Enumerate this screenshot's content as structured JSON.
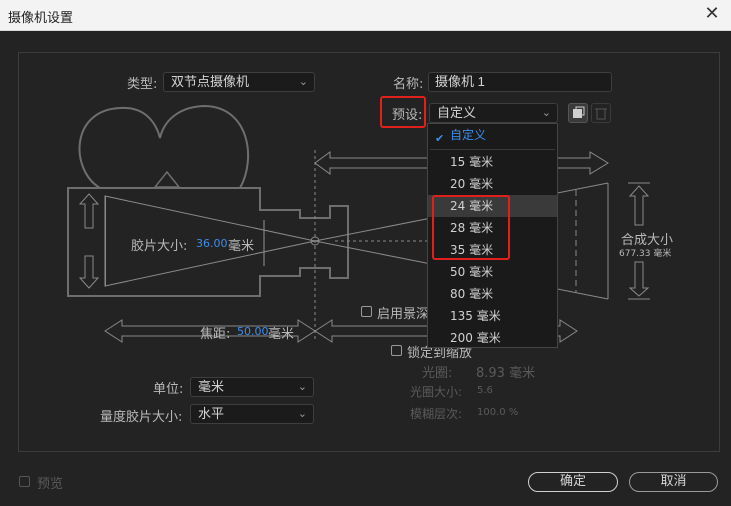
{
  "window": {
    "title": "摄像机设置",
    "close_glyph": "✕"
  },
  "type": {
    "label": "类型:",
    "value": "双节点摄像机"
  },
  "name": {
    "label": "名称:",
    "value": "摄像机 1"
  },
  "preset": {
    "label": "预设:",
    "value": "自定义",
    "options": [
      "自定义",
      "15 毫米",
      "20 毫米",
      "24 毫米",
      "28 毫米",
      "35 毫米",
      "50 毫米",
      "80 毫米",
      "135 毫米",
      "200 毫米"
    ],
    "selected_index": 0,
    "hovered_index": 3
  },
  "film_size": {
    "label": "胶片大小:",
    "value": "36.00",
    "unit": "毫米"
  },
  "focal": {
    "label": "焦距:",
    "value": "50.00",
    "unit": "毫米"
  },
  "comp_size": {
    "label": "合成大小",
    "value": "677.33 毫米"
  },
  "dof": {
    "label": "启用景深"
  },
  "lock_zoom": {
    "label": "锁定到缩放"
  },
  "aperture": {
    "label": "光圈:",
    "value": "8.93 毫米"
  },
  "fstop": {
    "label": "光圈大小:",
    "value": "5.6"
  },
  "blur": {
    "label": "模糊层次:",
    "value": "100.0 %"
  },
  "units": {
    "label": "单位:",
    "value": "毫米"
  },
  "measure": {
    "label": "量度胶片大小:",
    "value": "水平"
  },
  "preview": {
    "label": "预览"
  },
  "buttons": {
    "ok": "确定",
    "cancel": "取消"
  },
  "colors": {
    "accent": "#3d8ee9",
    "highlight_box": "#e0201a",
    "bg": "#232323"
  }
}
